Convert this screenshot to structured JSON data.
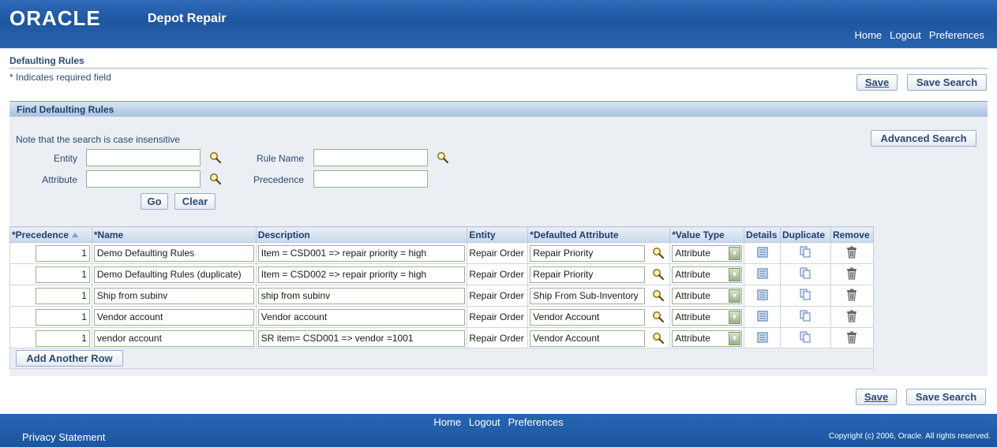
{
  "header": {
    "logo_text": "ORACLE",
    "app_title": "Depot Repair",
    "links": [
      "Home",
      "Logout",
      "Preferences"
    ]
  },
  "page": {
    "title": "Defaulting Rules",
    "required_note": "* Indicates required field",
    "save_label": "Save",
    "save_search_label": "Save Search"
  },
  "search": {
    "section_title": "Find Defaulting Rules",
    "case_note": "Note that the search is case insensitive",
    "advanced_search_label": "Advanced Search",
    "entity_label": "Entity",
    "entity_value": "",
    "attribute_label": "Attribute",
    "attribute_value": "",
    "rule_name_label": "Rule Name",
    "rule_name_value": "",
    "precedence_label": "Precedence",
    "precedence_value": "",
    "go_label": "Go",
    "clear_label": "Clear"
  },
  "table": {
    "columns": [
      "*Precedence",
      "*Name",
      "Description",
      "Entity",
      "*Defaulted Attribute",
      "*Value Type",
      "Details",
      "Duplicate",
      "Remove"
    ],
    "rows": [
      {
        "precedence": "1",
        "name": "Demo Defaulting Rules",
        "description": "Item = CSD001 => repair priority = high",
        "entity": "Repair Order",
        "attribute": "Repair Priority",
        "value_type": "Attribute"
      },
      {
        "precedence": "1",
        "name": "Demo Defaulting Rules (duplicate)",
        "description": "Item = CSD002 => repair priority = high",
        "entity": "Repair Order",
        "attribute": "Repair Priority",
        "value_type": "Attribute"
      },
      {
        "precedence": "1",
        "name": "Ship from subinv",
        "description": "ship from subinv",
        "entity": "Repair Order",
        "attribute": "Ship From Sub-Inventory",
        "value_type": "Attribute"
      },
      {
        "precedence": "1",
        "name": "Vendor account",
        "description": "Vendor account",
        "entity": "Repair Order",
        "attribute": "Vendor Account",
        "value_type": "Attribute"
      },
      {
        "precedence": "1",
        "name": "vendor account",
        "description": "SR item= CSD001 => vendor =1001",
        "entity": "Repair Order",
        "attribute": "Vendor Account",
        "value_type": "Attribute"
      }
    ],
    "add_row_label": "Add Another Row",
    "sort_icon": "sort-ascending-icon",
    "lov_icon": "search-icon",
    "details_icon": "details-icon",
    "duplicate_icon": "duplicate-icon",
    "remove_icon": "trash-icon"
  },
  "footer": {
    "links": [
      "Home",
      "Logout",
      "Preferences"
    ],
    "privacy": "Privacy Statement",
    "copyright": "Copyright (c) 2006, Oracle. All rights reserved."
  },
  "colors": {
    "brand_blue": "#1e56a0",
    "label_text": "#2c4a73",
    "input_border": "#9bb08f"
  }
}
